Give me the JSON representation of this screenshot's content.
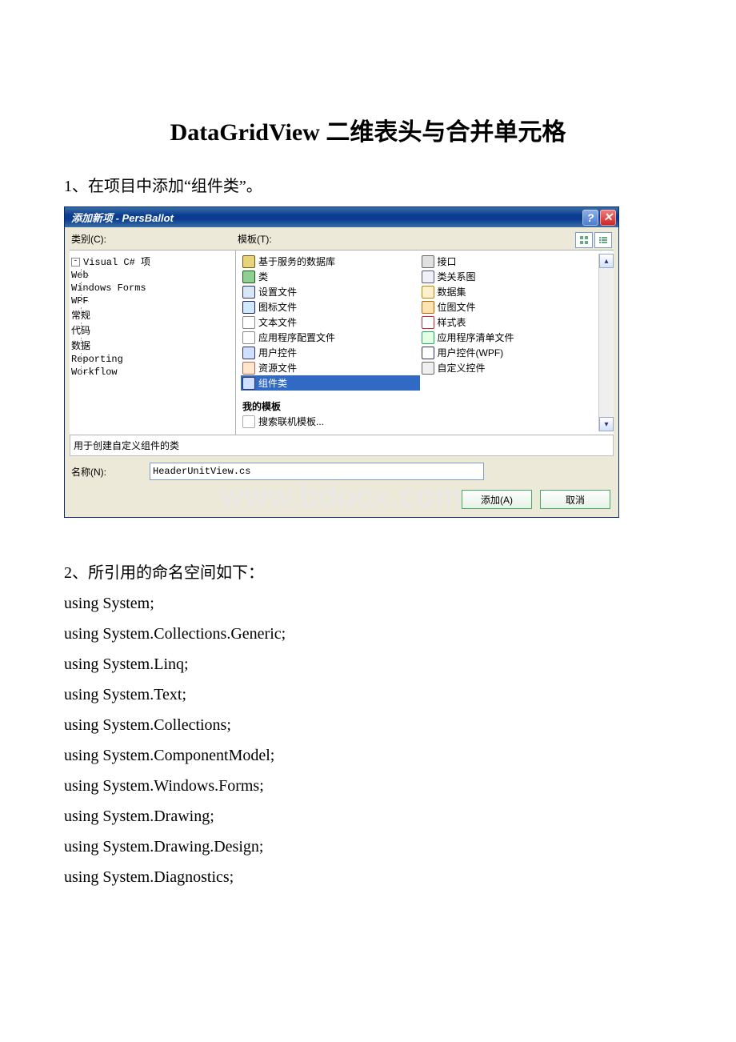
{
  "document": {
    "title": "DataGridView 二维表头与合并单元格",
    "step1": "1、在项目中添加“组件类”。",
    "step2": "2、所引用的命名空间如下：",
    "code_lines": [
      "using System;",
      "using System.Collections.Generic;",
      "using System.Linq;",
      "using System.Text;",
      "using System.Collections;",
      "using System.ComponentModel;",
      "using System.Windows.Forms;",
      "using System.Drawing;",
      "using System.Drawing.Design;",
      "using System.Diagnostics;"
    ]
  },
  "dialog": {
    "title": "添加新项 - PersBallot",
    "labels": {
      "categories": "类别(C):",
      "templates": "模板(T):",
      "my_templates": "我的模板",
      "search_online": "搜索联机模板...",
      "description": "用于创建自定义组件的类",
      "name": "名称(N):"
    },
    "tree": {
      "root": "Visual C# 项",
      "children": [
        "Web",
        "Windows Forms",
        "WPF",
        "常规",
        "代码",
        "数据",
        "Reporting",
        "Workflow"
      ]
    },
    "templates_col1": [
      {
        "label": "基于服务的数据库",
        "icon_bg": "#e7d47a",
        "icon_fg": "#6a5a10"
      },
      {
        "label": "类",
        "icon_bg": "#8fcf8f",
        "icon_fg": "#1a5a1a"
      },
      {
        "label": "设置文件",
        "icon_bg": "#d7e7f7",
        "icon_fg": "#336"
      },
      {
        "label": "图标文件",
        "icon_bg": "#cfe9ff",
        "icon_fg": "#225"
      },
      {
        "label": "文本文件",
        "icon_bg": "#fff",
        "icon_fg": "#888"
      },
      {
        "label": "应用程序配置文件",
        "icon_bg": "#fff",
        "icon_fg": "#888"
      },
      {
        "label": "用户控件",
        "icon_bg": "#cfe0ff",
        "icon_fg": "#336"
      },
      {
        "label": "资源文件",
        "icon_bg": "#ffe6cc",
        "icon_fg": "#a65"
      },
      {
        "label": "组件类",
        "icon_bg": "#cfe0ff",
        "icon_fg": "#336",
        "selected": true
      }
    ],
    "templates_col2": [
      {
        "label": "接口",
        "icon_bg": "#e0e0e0",
        "icon_fg": "#666"
      },
      {
        "label": "类关系图",
        "icon_bg": "#f0f0f8",
        "icon_fg": "#557"
      },
      {
        "label": "数据集",
        "icon_bg": "#fff0cc",
        "icon_fg": "#b80"
      },
      {
        "label": "位图文件",
        "icon_bg": "#ffe4b0",
        "icon_fg": "#b60"
      },
      {
        "label": "样式表",
        "icon_bg": "#fff",
        "icon_fg": "#c23"
      },
      {
        "label": "应用程序清单文件",
        "icon_bg": "#e5ffe5",
        "icon_fg": "#2a6"
      },
      {
        "label": "用户控件(WPF)",
        "icon_bg": "#fff",
        "icon_fg": "#336"
      },
      {
        "label": "自定义控件",
        "icon_bg": "#f0f0f0",
        "icon_fg": "#666"
      }
    ],
    "name_value": "HeaderUnitView.cs",
    "buttons": {
      "add": "添加(A)",
      "cancel": "取消"
    },
    "watermark": "www.bdocx.com"
  }
}
